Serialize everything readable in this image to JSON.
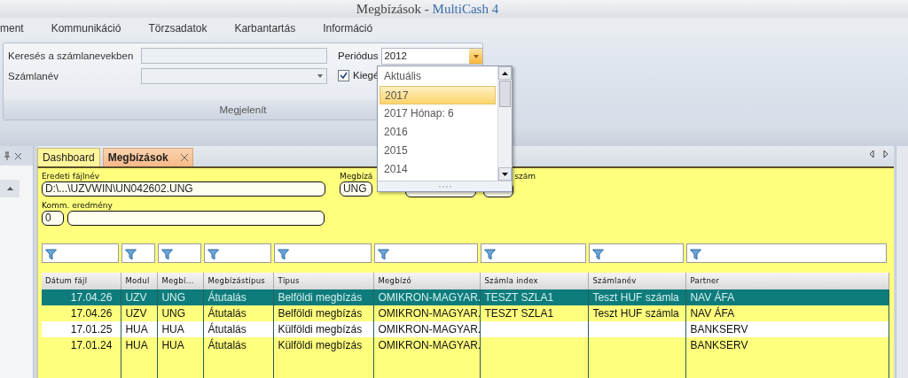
{
  "window": {
    "title": "Megbízások - ",
    "app_name": "MultiCash 4"
  },
  "menu": [
    {
      "label": "ment"
    },
    {
      "label": "Kommunikáció"
    },
    {
      "label": "Törzsadatok"
    },
    {
      "label": "Karbantartás"
    },
    {
      "label": "Információ"
    }
  ],
  "ribbon": {
    "search_label": "Keresés a számlanevekben",
    "account_label": "Számlanév",
    "period_label": "Periódus",
    "period_value": "2012",
    "checkbox": {
      "label": "Kiegé",
      "checked": true
    },
    "group_label": "Megjelenít"
  },
  "period_dropdown": [
    {
      "label": "Aktuális",
      "selected": false
    },
    {
      "label": "2017",
      "selected": true
    },
    {
      "label": "2017 Hónap: 6",
      "selected": false
    },
    {
      "label": "2016",
      "selected": false
    },
    {
      "label": "2015",
      "selected": false
    },
    {
      "label": "2014",
      "selected": false
    }
  ],
  "tabs": [
    {
      "label": "Dashboard",
      "selected": false,
      "closable": false
    },
    {
      "label": "Megbízások",
      "selected": true,
      "closable": true
    }
  ],
  "details": {
    "file_label": "Eredeti fájlnév",
    "file_value": "D:\\...\\UZVWIN\\UN042602.UNG",
    "order_label": "Megbízá",
    "order_value": "UNG",
    "number_label": "szám",
    "result_label": "Komm. eredmény",
    "result_code": "0"
  },
  "table": {
    "columns": [
      {
        "label": "Dátum fájl",
        "filter": true
      },
      {
        "label": "Modul",
        "filter": true
      },
      {
        "label": "Megbí...",
        "filter": true
      },
      {
        "label": "Megbízástípus",
        "filter": true
      },
      {
        "label": "Típus",
        "filter": true
      },
      {
        "label": "Megbízó",
        "filter": true
      },
      {
        "label": "Számla index",
        "filter": true
      },
      {
        "label": "Számlanév",
        "filter": true
      },
      {
        "label": "Partner",
        "filter": true
      }
    ],
    "rows": [
      {
        "selected": true,
        "hovered": false,
        "cells": [
          "17.04.26",
          "UZV",
          "UNG",
          "Átutalás",
          "Belföldi megbízás",
          "OMIKRON-MAGYAR.",
          "TESZT SZLA1",
          "Teszt HUF számla",
          "NAV ÁFA"
        ]
      },
      {
        "selected": false,
        "hovered": false,
        "cells": [
          "17.04.26",
          "UZV",
          "UNG",
          "Átutalás",
          "Belföldi megbízás",
          "OMIKRON-MAGYAR.",
          "TESZT SZLA1",
          "Teszt HUF számla",
          "NAV ÁFA"
        ]
      },
      {
        "selected": false,
        "hovered": true,
        "cells": [
          "17.01.25",
          "HUA",
          "HUA",
          "Átutalás",
          "Külföldi megbízás",
          "OMIKRON-MAGYAR.",
          null,
          null,
          "BANKSERV"
        ]
      },
      {
        "selected": false,
        "hovered": false,
        "cells": [
          "17.01.24",
          "HUA",
          "HUA",
          "Átutalás",
          "Külföldi megbízás",
          "OMIKRON-MAGYAR.",
          null,
          null,
          "BANKSERV"
        ]
      }
    ]
  }
}
